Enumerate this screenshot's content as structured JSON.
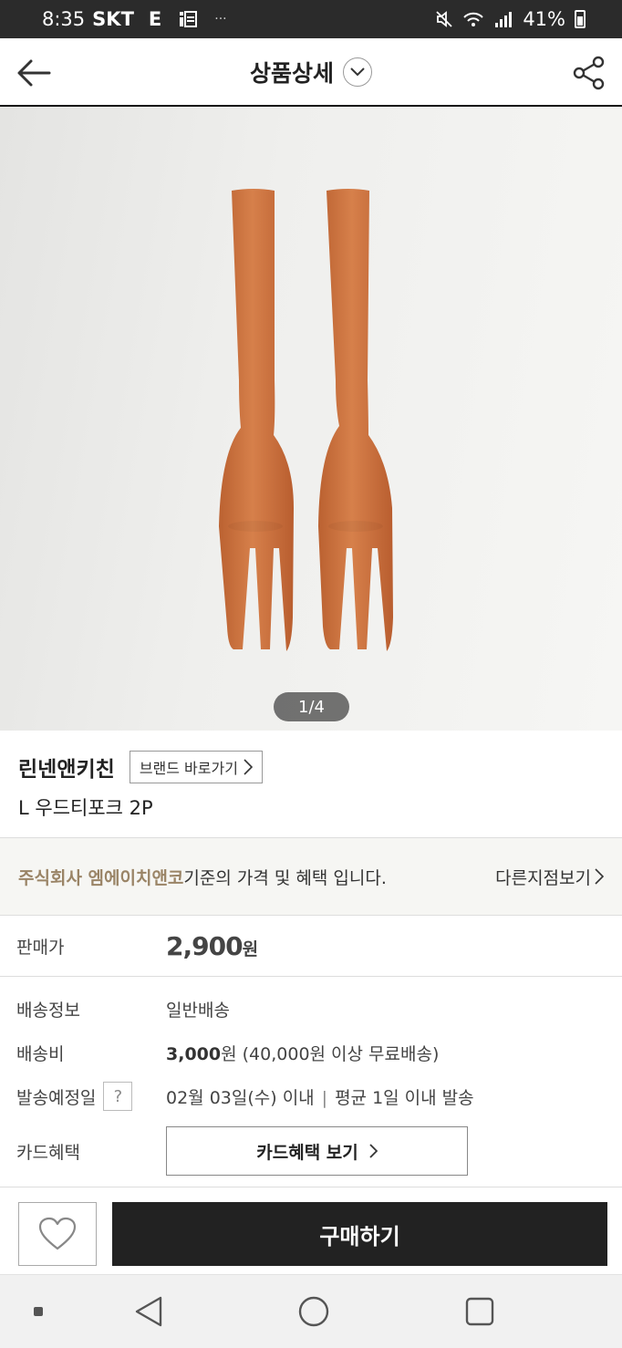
{
  "status_bar": {
    "time": "8:35",
    "carrier": "SKT",
    "network": "E",
    "battery": "41%",
    "dots": "···"
  },
  "header": {
    "title": "상품상세"
  },
  "gallery": {
    "page_indicator": "1/4",
    "current": 1,
    "total": 4
  },
  "product": {
    "brand": "린넨앤키친",
    "brand_link": "브랜드 바로가기",
    "name": "L 우드티포크 2P"
  },
  "notice": {
    "company": "주식회사 엠에이치앤코",
    "message": "기준의 가격 및 혜택 입니다.",
    "other_stores": "다른지점보기"
  },
  "price": {
    "label": "판매가",
    "value": "2,900",
    "unit": "원"
  },
  "shipping": {
    "info_label": "배송정보",
    "info_value": "일반배송",
    "fee_label": "배송비",
    "fee_amount": "3,000",
    "fee_unit": "원",
    "fee_note": "(40,000원 이상 무료배송)",
    "date_label": "발송예정일",
    "help": "?",
    "date_value": "02월 03일(수) 이내",
    "separator": "|",
    "date_avg": "평균 1일 이내 발송"
  },
  "card": {
    "label": "카드혜택",
    "button": "카드혜택 보기"
  },
  "actions": {
    "buy": "구매하기"
  },
  "colors": {
    "accent_brown": "#9a8466",
    "buy_button": "#222222",
    "fork_wood": "#c86a33"
  }
}
